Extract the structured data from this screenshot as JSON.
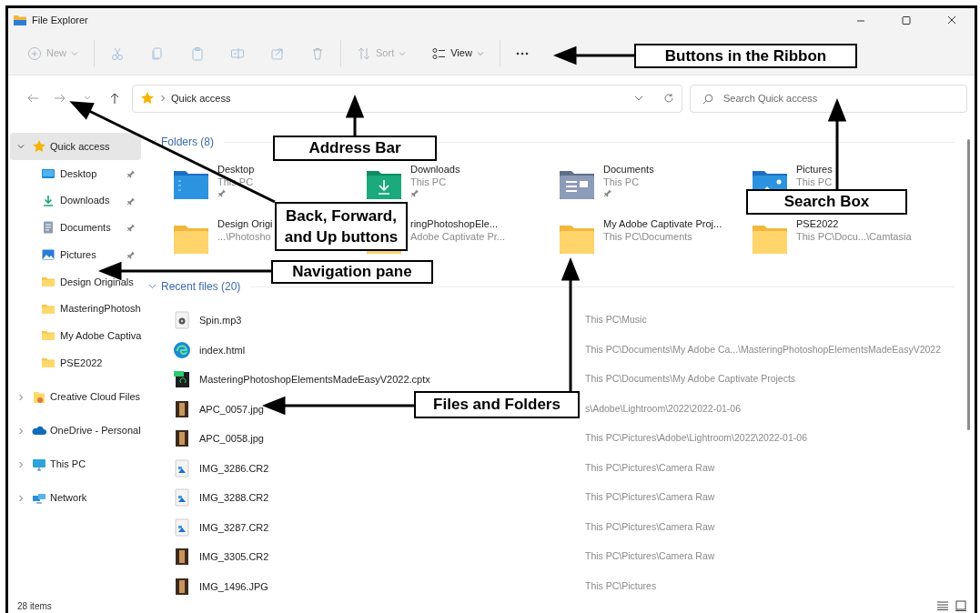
{
  "window": {
    "title": "File Explorer"
  },
  "ribbon": {
    "buttons": [
      {
        "kind": "new",
        "label": "New",
        "disabled": true
      },
      {
        "kind": "cut",
        "disabled": true
      },
      {
        "kind": "copy",
        "disabled": true
      },
      {
        "kind": "paste",
        "disabled": true
      },
      {
        "kind": "rename",
        "disabled": true
      },
      {
        "kind": "share",
        "disabled": true
      },
      {
        "kind": "delete",
        "disabled": true
      },
      {
        "kind": "sort",
        "label": "Sort",
        "disabled": true
      },
      {
        "kind": "view",
        "label": "View",
        "disabled": false
      },
      {
        "kind": "more",
        "disabled": false
      }
    ]
  },
  "address_bar": {
    "path": "Quick access"
  },
  "search": {
    "placeholder": "Search Quick access"
  },
  "navigation": [
    {
      "kind": "star",
      "label": "Quick access",
      "expanded": true,
      "selected": true,
      "children": [
        {
          "kind": "desktop",
          "label": "Desktop",
          "pinned": true,
          "selected": false
        },
        {
          "kind": "downloads",
          "label": "Downloads",
          "pinned": true,
          "selected": false
        },
        {
          "kind": "documents",
          "label": "Documents",
          "pinned": true,
          "selected": false
        },
        {
          "kind": "pictures",
          "label": "Pictures",
          "pinned": true,
          "selected": false
        },
        {
          "kind": "folder",
          "label": "Design Originals",
          "pinned": false,
          "selected": false
        },
        {
          "kind": "folder",
          "label": "MasteringPhotosh",
          "pinned": false,
          "selected": false
        },
        {
          "kind": "folder",
          "label": "My Adobe Captiva",
          "pinned": false,
          "selected": false
        },
        {
          "kind": "folder",
          "label": "PSE2022",
          "pinned": false,
          "selected": false
        }
      ]
    },
    {
      "kind": "cloud-files",
      "label": "Creative Cloud Files",
      "expanded": false,
      "selected": false
    },
    {
      "kind": "onedrive",
      "label": "OneDrive - Personal",
      "expanded": false,
      "selected": false
    },
    {
      "kind": "pc",
      "label": "This PC",
      "expanded": false,
      "selected": false
    },
    {
      "kind": "network",
      "label": "Network",
      "expanded": false,
      "selected": false
    }
  ],
  "folders": {
    "title": "Folders (8)",
    "items": [
      {
        "kind": "desktop",
        "name": "Desktop",
        "location": "This PC",
        "pinned": true
      },
      {
        "kind": "downloads",
        "name": "Downloads",
        "location": "This PC",
        "pinned": true
      },
      {
        "kind": "documents",
        "name": "Documents",
        "location": "This PC",
        "pinned": true
      },
      {
        "kind": "pictures",
        "name": "Pictures",
        "location": "This PC",
        "pinned": false
      },
      {
        "kind": "folder",
        "name": "Design Origi",
        "location": "...\\Photosho",
        "pinned": false
      },
      {
        "kind": "folder",
        "name": "ringPhotoshopEle...",
        "location": "Adobe Captivate Pr...",
        "pinned": false
      },
      {
        "kind": "folder",
        "name": "My Adobe Captivate Proj...",
        "location": "This PC\\Documents",
        "pinned": false
      },
      {
        "kind": "folder",
        "name": "PSE2022",
        "location": "This PC\\Docu...\\Camtasia",
        "pinned": false
      }
    ]
  },
  "recent_files": {
    "title": "Recent files (20)",
    "rows": [
      {
        "kind": "audio",
        "name": "Spin.mp3",
        "location": "This PC\\Music"
      },
      {
        "kind": "web",
        "name": "index.html",
        "location": "This PC\\Documents\\My Adobe Ca...\\MasteringPhotoshopElementsMadeEasyV2022"
      },
      {
        "kind": "project",
        "name": "MasteringPhotoshopElementsMadeEasyV2022.cptx",
        "location": "This PC\\Documents\\My Adobe Captivate Projects"
      },
      {
        "kind": "photo",
        "name": "APC_0057.jpg",
        "location": "s\\Adobe\\Lightroom\\2022\\2022-01-06"
      },
      {
        "kind": "photo",
        "name": "APC_0058.jpg",
        "location": "This PC\\Pictures\\Adobe\\Lightroom\\2022\\2022-01-06"
      },
      {
        "kind": "raw",
        "name": "IMG_3286.CR2",
        "location": "This PC\\Pictures\\Camera Raw"
      },
      {
        "kind": "raw",
        "name": "IMG_3288.CR2",
        "location": "This PC\\Pictures\\Camera Raw"
      },
      {
        "kind": "raw",
        "name": "IMG_3287.CR2",
        "location": "This PC\\Pictures\\Camera Raw"
      },
      {
        "kind": "photo",
        "name": "IMG_3305.CR2",
        "location": "This PC\\Pictures\\Camera Raw"
      },
      {
        "kind": "photo",
        "name": "IMG_1496.JPG",
        "location": "This PC\\Pictures"
      }
    ]
  },
  "status_bar": {
    "item_count": "28 items"
  },
  "callouts": [
    {
      "text": "Buttons in the Ribbon"
    },
    {
      "text": "Address Bar"
    },
    {
      "text": "Back, Forward, and Up buttons"
    },
    {
      "text": "Search Box"
    },
    {
      "text": "Navigation pane"
    },
    {
      "text": "Files and Folders"
    }
  ]
}
